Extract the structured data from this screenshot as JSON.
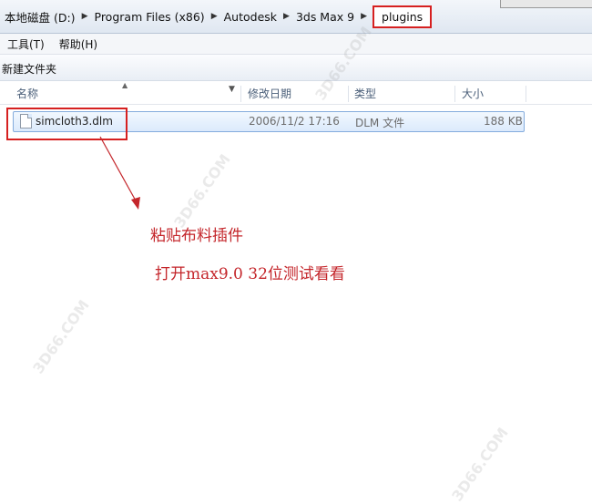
{
  "address": {
    "crumbs": [
      "本地磁盘 (D:)",
      "Program Files (x86)",
      "Autodesk",
      "3ds Max 9",
      "plugins"
    ],
    "separator": "▶"
  },
  "menu": {
    "tools": "工具(T)",
    "help": "帮助(H)"
  },
  "command": {
    "new_folder": "新建文件夹"
  },
  "columns": {
    "name": "名称",
    "modified": "修改日期",
    "type": "类型",
    "size": "大小"
  },
  "files": [
    {
      "name": "simcloth3.dlm",
      "modified": "2006/11/2 17:16",
      "type": "DLM 文件",
      "size": "188 KB"
    }
  ],
  "annotations": {
    "line1": "粘贴布料插件",
    "line2": "打开max9.0 32位测试看看",
    "color": "#c4262b"
  },
  "watermark": "3D66.COM"
}
